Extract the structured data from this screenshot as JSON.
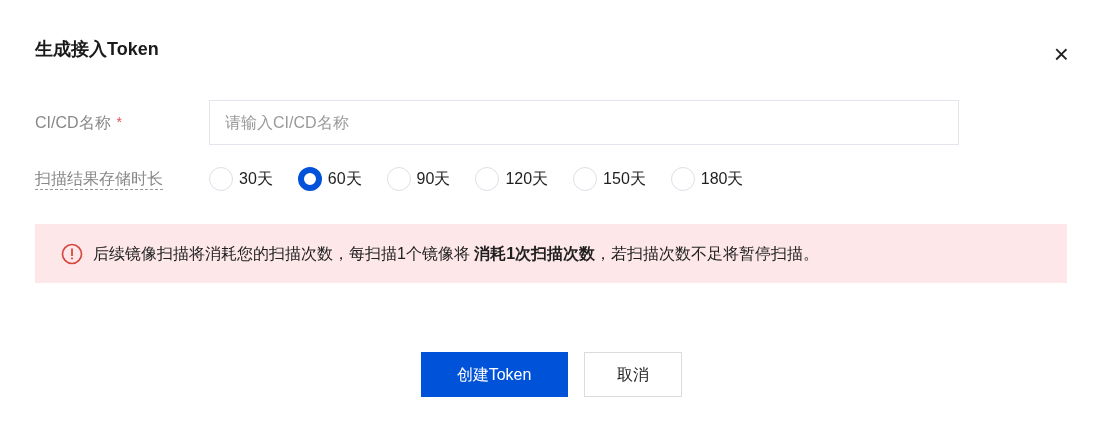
{
  "dialog": {
    "title": "生成接入Token",
    "close": "×"
  },
  "name_field": {
    "label": "CI/CD名称",
    "required_mark": "*",
    "placeholder": "请输入CI/CD名称"
  },
  "retention": {
    "label": "扫描结果存储时长",
    "options": [
      {
        "label": "30天",
        "selected": false
      },
      {
        "label": "60天",
        "selected": true
      },
      {
        "label": "90天",
        "selected": false
      },
      {
        "label": "120天",
        "selected": false
      },
      {
        "label": "150天",
        "selected": false
      },
      {
        "label": "180天",
        "selected": false
      }
    ]
  },
  "alert": {
    "kind": "error",
    "text": "后续镜像扫描将消耗您的扫描次数，每扫描1个镜像将 **消耗1次扫描次数**，若扫描次数不足将暂停扫描。"
  },
  "buttons": [
    {
      "label": "创建Token",
      "kind": "primary"
    },
    {
      "label": "取消",
      "kind": "secondary"
    }
  ]
}
